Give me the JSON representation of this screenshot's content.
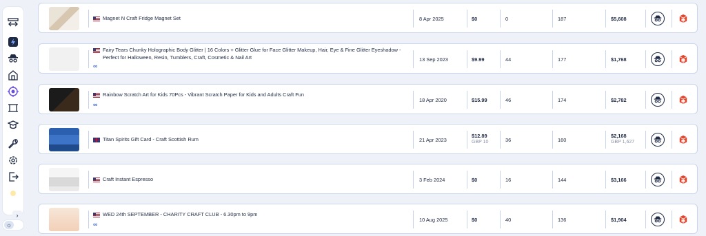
{
  "sidebar": {
    "icons": [
      "arrows-icon",
      "bolt-icon",
      "spy-icon",
      "store-icon",
      "target-icon",
      "frame-icon",
      "graduation-icon",
      "wrench-icon",
      "gear-icon",
      "logout-icon",
      "bulb-icon"
    ],
    "expand_glyph": "›",
    "theme_glyph": "☼"
  },
  "rows": [
    {
      "title": "Magnet N Craft Fridge Magnet Set",
      "country": "US",
      "date": "8 Apr 2025",
      "price": "$0",
      "price_sub": "",
      "col3": "0",
      "col4": "187",
      "revenue": "$5,608",
      "revenue_sub": "",
      "meta": ""
    },
    {
      "title": "Fairy Tears Chunky Holographic Body Glitter | 16 Colors + Glitter Glue for Face Glitter Makeup, Hair, Eye & Fine Glitter Eyeshadow - Perfect for Halloween, Resin, Tumblers, Craft, Cosmetic & Nail Art",
      "country": "US",
      "date": "13 Sep 2023",
      "price": "$9.99",
      "price_sub": "",
      "col3": "44",
      "col4": "177",
      "revenue": "$1,768",
      "revenue_sub": "",
      "meta": "∞"
    },
    {
      "title": "Rainbow Scratch Art for Kids 70Pcs - Vibrant Scratch Paper for Kids and Adults Craft Fun",
      "country": "US",
      "date": "18 Apr 2020",
      "price": "$15.99",
      "price_sub": "",
      "col3": "46",
      "col4": "174",
      "revenue": "$2,782",
      "revenue_sub": "",
      "meta": "∞"
    },
    {
      "title": "Titan Spirits Gift Card - Craft Scottish Rum",
      "country": "UK",
      "date": "21 Apr 2023",
      "price": "$12.89",
      "price_sub": "GBP 10",
      "col3": "36",
      "col4": "160",
      "revenue": "$2,168",
      "revenue_sub": "GBP 1,627",
      "meta": ""
    },
    {
      "title": "Craft Instant Espresso",
      "country": "US",
      "date": "3 Feb 2024",
      "price": "$0",
      "price_sub": "",
      "col3": "16",
      "col4": "144",
      "revenue": "$3,166",
      "revenue_sub": "",
      "meta": ""
    },
    {
      "title": "WED 24th SEPTEMBER - CHARITY CRAFT CLUB - 6.30pm to 9pm",
      "country": "US",
      "date": "10 Aug 2025",
      "price": "$0",
      "price_sub": "",
      "col3": "40",
      "col4": "136",
      "revenue": "$1,904",
      "revenue_sub": "",
      "meta": "∞"
    }
  ],
  "colors": {
    "accent": "#4a6fd8",
    "border": "#c9d6ee",
    "box": "#e0452c"
  }
}
